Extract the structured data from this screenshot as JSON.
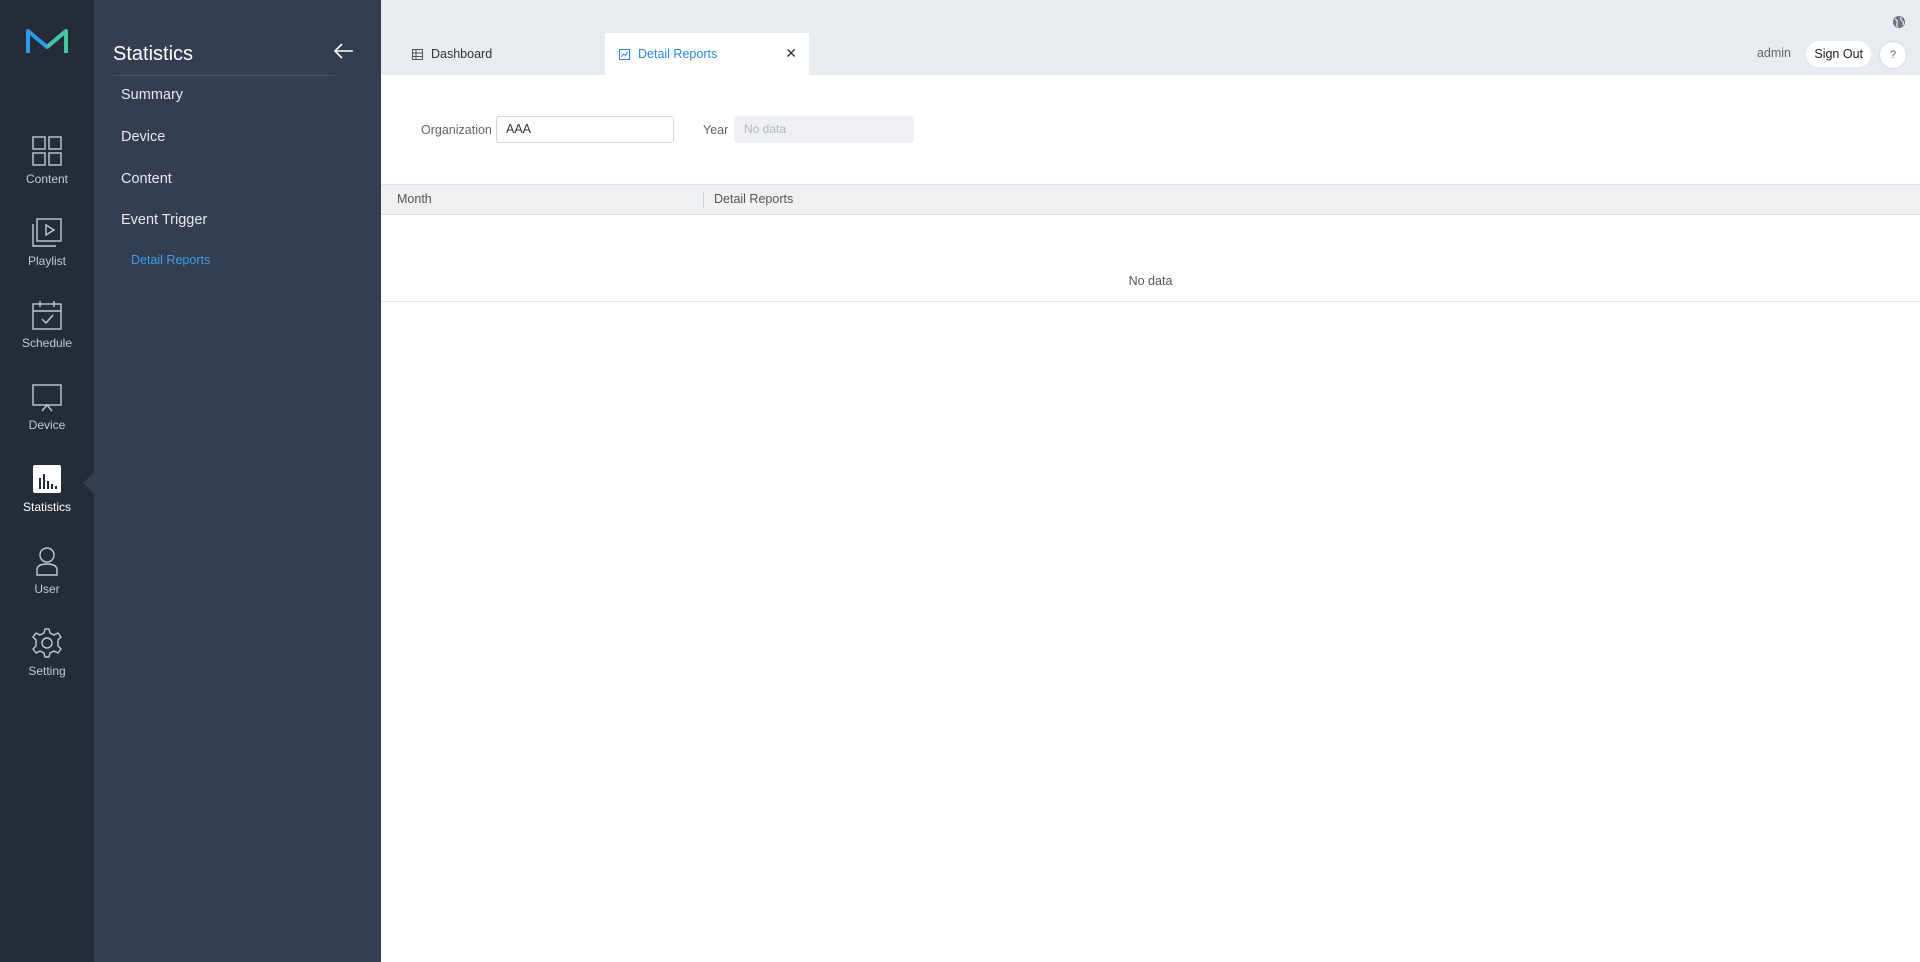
{
  "colors": {
    "rail_bg": "#252b38",
    "sidebar_bg": "#353e50",
    "accent": "#2a8ae6",
    "topbar_bg": "#e8ebef"
  },
  "rail": {
    "items": [
      {
        "label": "Content",
        "icon": "grid-icon"
      },
      {
        "label": "Playlist",
        "icon": "playlist-icon"
      },
      {
        "label": "Schedule",
        "icon": "calendar-icon"
      },
      {
        "label": "Device",
        "icon": "monitor-icon"
      },
      {
        "label": "Statistics",
        "icon": "bar-chart-icon",
        "active": true
      },
      {
        "label": "User",
        "icon": "user-icon"
      },
      {
        "label": "Setting",
        "icon": "gear-icon"
      }
    ]
  },
  "sidebar": {
    "title": "Statistics",
    "items": [
      {
        "label": "Summary"
      },
      {
        "label": "Device"
      },
      {
        "label": "Content"
      },
      {
        "label": "Event Trigger"
      }
    ],
    "sub_item": "Detail Reports"
  },
  "tabs": [
    {
      "label": "Dashboard",
      "icon": "dashboard-icon"
    },
    {
      "label": "Detail Reports",
      "icon": "report-icon",
      "active": true,
      "close": "✕"
    }
  ],
  "header": {
    "user": "admin",
    "sign_out": "Sign Out",
    "help": "?"
  },
  "filter": {
    "organization_label": "Organization",
    "organization_value": "AAA",
    "year_label": "Year",
    "year_placeholder": "No data"
  },
  "table": {
    "columns": [
      "Month",
      "Detail Reports"
    ],
    "empty_text": "No data"
  }
}
